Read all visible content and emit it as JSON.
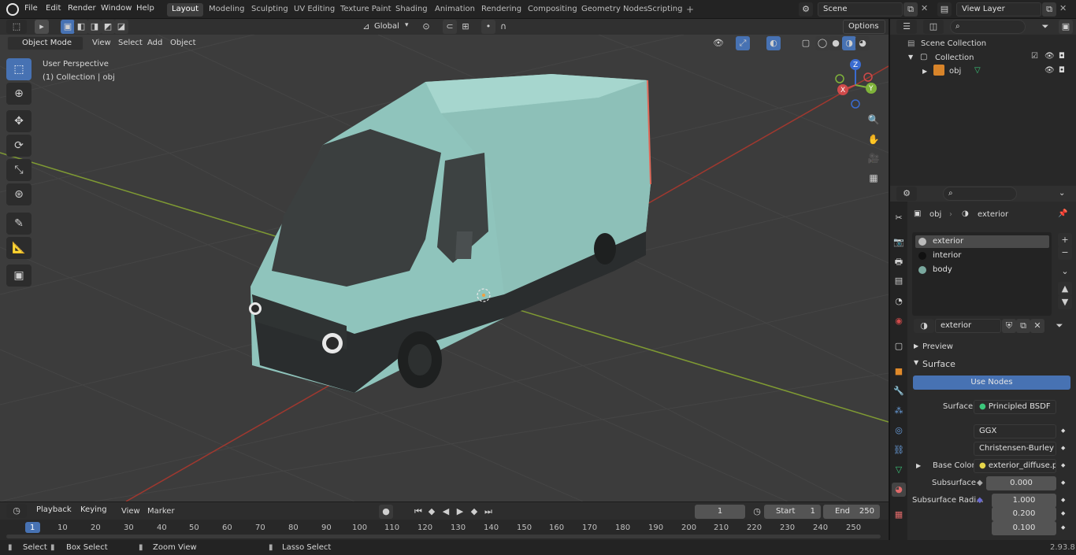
{
  "app": {
    "logo": "blender-logo-icon"
  },
  "menu": {
    "file": "File",
    "edit": "Edit",
    "render": "Render",
    "window": "Window",
    "help": "Help"
  },
  "workspaces": [
    "Layout",
    "Modeling",
    "Sculpting",
    "UV Editing",
    "Texture Paint",
    "Shading",
    "Animation",
    "Rendering",
    "Compositing",
    "Geometry Nodes",
    "Scripting"
  ],
  "scene": {
    "name": "Scene",
    "view_layer": "View Layer"
  },
  "viewport": {
    "mode": "Object Mode",
    "menus": [
      "View",
      "Select",
      "Add",
      "Object"
    ],
    "orientation": "Global",
    "options": "Options",
    "overlay_title": "User Perspective",
    "overlay_sub": "(1) Collection | obj"
  },
  "gizmo": {
    "z": "Z",
    "y": "Y",
    "x": "X"
  },
  "outliner": {
    "scene_collection": "Scene Collection",
    "collection": "Collection",
    "obj": "obj"
  },
  "properties": {
    "object": "obj",
    "material": "exterior",
    "materials": [
      "exterior",
      "interior",
      "body"
    ],
    "material_field": "exterior",
    "preview": "Preview",
    "surface_panel": "Surface",
    "use_nodes": "Use Nodes",
    "surface_label": "Surface",
    "surface_value": "Principled BSDF",
    "distribution": "GGX",
    "subsurface_method": "Christensen-Burley",
    "base_color_label": "Base Color",
    "base_color_value": "exterior_diffuse.png",
    "subsurface_label": "Subsurface",
    "subsurface_value": "0.000",
    "subsurface_radius_label": "Subsurface Radi...",
    "radius": [
      "1.000",
      "0.200",
      "0.100"
    ]
  },
  "timeline": {
    "menus": [
      "Playback",
      "Keying",
      "View",
      "Marker"
    ],
    "current": "1",
    "start_label": "Start",
    "start": "1",
    "end_label": "End",
    "end": "250",
    "ticks": [
      "1",
      "10",
      "20",
      "30",
      "40",
      "50",
      "60",
      "70",
      "80",
      "90",
      "100",
      "110",
      "120",
      "130",
      "140",
      "150",
      "160",
      "170",
      "180",
      "190",
      "200",
      "210",
      "220",
      "230",
      "240",
      "250"
    ]
  },
  "status": {
    "select": "Select",
    "box_select": "Box Select",
    "zoom_view": "Zoom View",
    "lasso_select": "Lasso Select",
    "version": "2.93.8"
  },
  "colors": {
    "accent": "#4772b3",
    "van_body": "#8fc4bc",
    "x_axis": "#c0392b",
    "y_axis": "#8db33a"
  }
}
